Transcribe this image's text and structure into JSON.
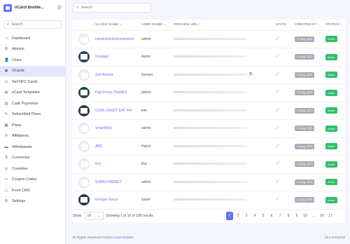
{
  "app": {
    "name": "vCard Builde...",
    "menu_icon": "hamburger-icon"
  },
  "sidebar": {
    "search_placeholder": "Search",
    "items": [
      {
        "label": "Dashboard",
        "icon": "dashboard-icon",
        "glyph": "⌂"
      },
      {
        "label": "Admins",
        "icon": "admins-icon",
        "glyph": "⚙"
      },
      {
        "label": "Users",
        "icon": "users-icon",
        "glyph": "👤"
      },
      {
        "label": "VCards",
        "icon": "vcards-icon",
        "glyph": "▣",
        "active": true
      },
      {
        "label": "Sell NFC Cards",
        "icon": "nfc-icon",
        "glyph": "▭"
      },
      {
        "label": "vCard Templates",
        "icon": "templates-icon",
        "glyph": "▤"
      },
      {
        "label": "Cash Payments",
        "icon": "cash-icon",
        "glyph": "▥"
      },
      {
        "label": "Subscribed Plans",
        "icon": "plans-subscribed-icon",
        "glyph": "✎"
      },
      {
        "label": "Plans",
        "icon": "plans-icon",
        "glyph": "▦"
      },
      {
        "label": "Affiliations",
        "icon": "affiliations-icon",
        "glyph": "⟳"
      },
      {
        "label": "Withdrawals",
        "icon": "withdrawals-icon",
        "glyph": "▬"
      },
      {
        "label": "Currencies",
        "icon": "currencies-icon",
        "glyph": "$"
      },
      {
        "label": "Countries",
        "icon": "countries-icon",
        "glyph": "◎"
      },
      {
        "label": "Coupon Codes",
        "icon": "coupon-icon",
        "glyph": "✂"
      },
      {
        "label": "Front CMS",
        "icon": "cms-icon",
        "glyph": "▢"
      },
      {
        "label": "Settings",
        "icon": "settings-icon",
        "glyph": "⚙"
      }
    ]
  },
  "topbar": {
    "search_placeholder": "Search"
  },
  "table": {
    "headers": [
      "VCARD NAME↑↓",
      "USER NAME↑↓",
      "PREVIEW URL↑↓",
      "STATS",
      "CREATED AT↑↓",
      "STATUS↑↓"
    ],
    "rows": [
      {
        "vcard": "hshshshshshshshshshsh",
        "user": "admin",
        "date": "19 Aug, 2023",
        "status": "Active",
        "avatar": "light",
        "copy": false
      },
      {
        "vcard": "Divulgali",
        "user": "Aamir",
        "date": "13 Aug, 2023",
        "status": "Active",
        "avatar": "blue",
        "copy": false
      },
      {
        "vcard": "Seif Ahmed",
        "user": "Noman",
        "date": "13 Aug, 2023",
        "status": "Active",
        "avatar": "light",
        "copy": true
      },
      {
        "vcard": "Digi Emmy (Teebillz)",
        "user": "admin",
        "date": "13 Aug, 2023",
        "status": "Active",
        "avatar": "green",
        "copy": false
      },
      {
        "vcard": "COOL CRAZY CAT #47",
        "user": "knk",
        "date": "13 Aug, 2023",
        "status": "Active",
        "avatar": "dark",
        "copy": false
      },
      {
        "vcard": "SmartWeb",
        "user": "admin",
        "date": "19 Aug, 2023",
        "status": "Active",
        "avatar": "light",
        "copy": false
      },
      {
        "vcard": "ABC",
        "user": "Harsh",
        "date": "13 Aug, 2023",
        "status": "Active",
        "avatar": "light",
        "copy": false
      },
      {
        "vcard": "test",
        "user": "Bar",
        "date": "13 Aug, 2023",
        "status": "Active",
        "avatar": "light",
        "copy": false
      },
      {
        "vcard": "SURAJ PANDEY",
        "user": "admin",
        "date": "13 Aug, 2023",
        "status": "Active",
        "avatar": "light",
        "copy": false
      },
      {
        "vcard": "Enrique Greco",
        "user": "Samir",
        "date": "13 Aug, 2023",
        "status": "Active",
        "avatar": "dark",
        "copy": false
      }
    ]
  },
  "pagination": {
    "show_label": "Show",
    "per_page": "10",
    "showing_text": "Showing 1 to 10 of 168 results",
    "prev": "‹",
    "pages": [
      "1",
      "2",
      "3",
      "4",
      "5",
      "6",
      "7",
      "8",
      "9",
      "10",
      "...",
      "16",
      "17"
    ],
    "next": "›",
    "current": "1"
  },
  "footer": {
    "rights_prefix": "All Rights Reserved ©2023",
    "brand": "vCard Builder",
    "version": "v8.2.0-Patch8"
  },
  "colors": {
    "accent": "#6571ff",
    "active_badge": "#2dbf68",
    "date_badge": "#a9adb8"
  }
}
